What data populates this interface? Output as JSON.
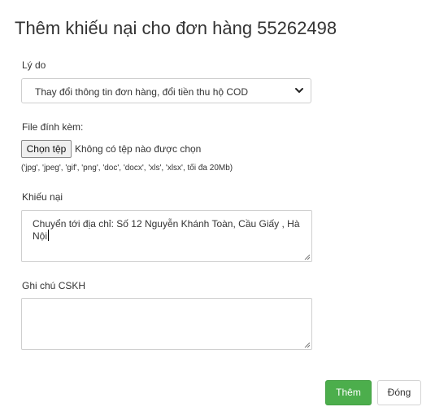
{
  "modal": {
    "title": "Thêm khiếu nại cho đơn hàng 55262498"
  },
  "reason": {
    "label": "Lý do",
    "selected": "Thay đổi thông tin đơn hàng, đổi tiền thu hộ COD"
  },
  "attachment": {
    "label": "File đính kèm:",
    "button_label": "Chọn tệp",
    "status": "Không có tệp nào được chọn",
    "hint": "('jpg', 'jpeg', 'gif', 'png', 'doc', 'docx', 'xls', 'xlsx', tối đa 20Mb)"
  },
  "complaint": {
    "label": "Khiếu nại",
    "value": "Chuyển tới địa chỉ: Số 12 Nguyễn Khánh Toàn, Cầu Giấy , Hà Nội"
  },
  "cskh_note": {
    "label": "Ghi chú CSKH",
    "value": ""
  },
  "footer": {
    "submit_label": "Thêm",
    "close_label": "Đóng"
  },
  "colors": {
    "primary_button": "#4cae4c",
    "border": "#cfcfcf"
  },
  "icons": {
    "select_arrow": "chevron-down-icon",
    "resize": "resize-grip-icon"
  }
}
